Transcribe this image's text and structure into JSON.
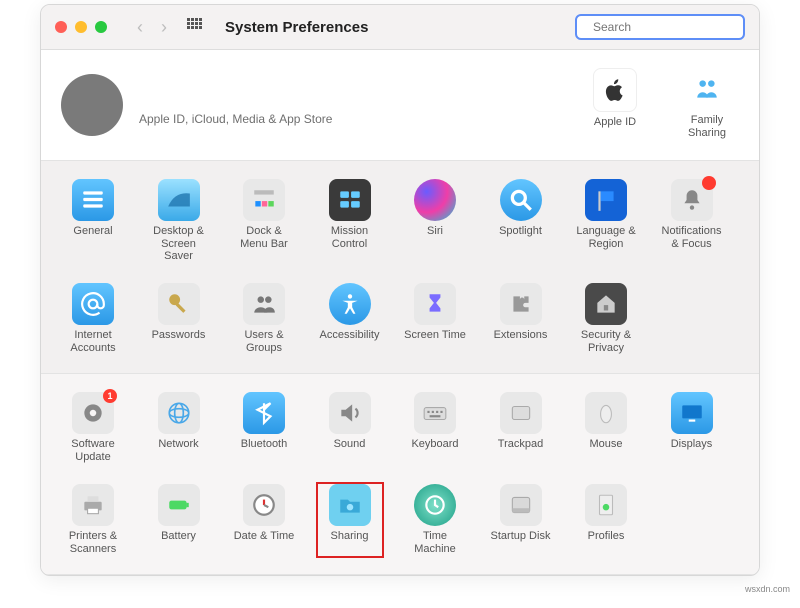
{
  "window": {
    "title": "System Preferences"
  },
  "search": {
    "placeholder": "Search"
  },
  "account": {
    "subtitle": "Apple ID, iCloud, Media & App Store"
  },
  "side": {
    "appleid": "Apple ID",
    "family": "Family Sharing"
  },
  "rows": {
    "general": "General",
    "desktop": "Desktop & Screen Saver",
    "dock": "Dock & Menu Bar",
    "mission": "Mission Control",
    "siri": "Siri",
    "spotlight": "Spotlight",
    "language": "Language & Region",
    "notifications": "Notifications & Focus",
    "internet": "Internet Accounts",
    "passwords": "Passwords",
    "users": "Users & Groups",
    "accessibility": "Accessibility",
    "screentime": "Screen Time",
    "extensions": "Extensions",
    "security": "Security & Privacy",
    "swupdate": "Software Update",
    "network": "Network",
    "bluetooth": "Bluetooth",
    "sound": "Sound",
    "keyboard": "Keyboard",
    "trackpad": "Trackpad",
    "mouse": "Mouse",
    "displays": "Displays",
    "printers": "Printers & Scanners",
    "battery": "Battery",
    "datetime": "Date & Time",
    "sharing": "Sharing",
    "timemachine": "Time Machine",
    "startup": "Startup Disk",
    "profiles": "Profiles"
  },
  "badges": {
    "swupdate": "1"
  },
  "footer": "wsxdn.com"
}
